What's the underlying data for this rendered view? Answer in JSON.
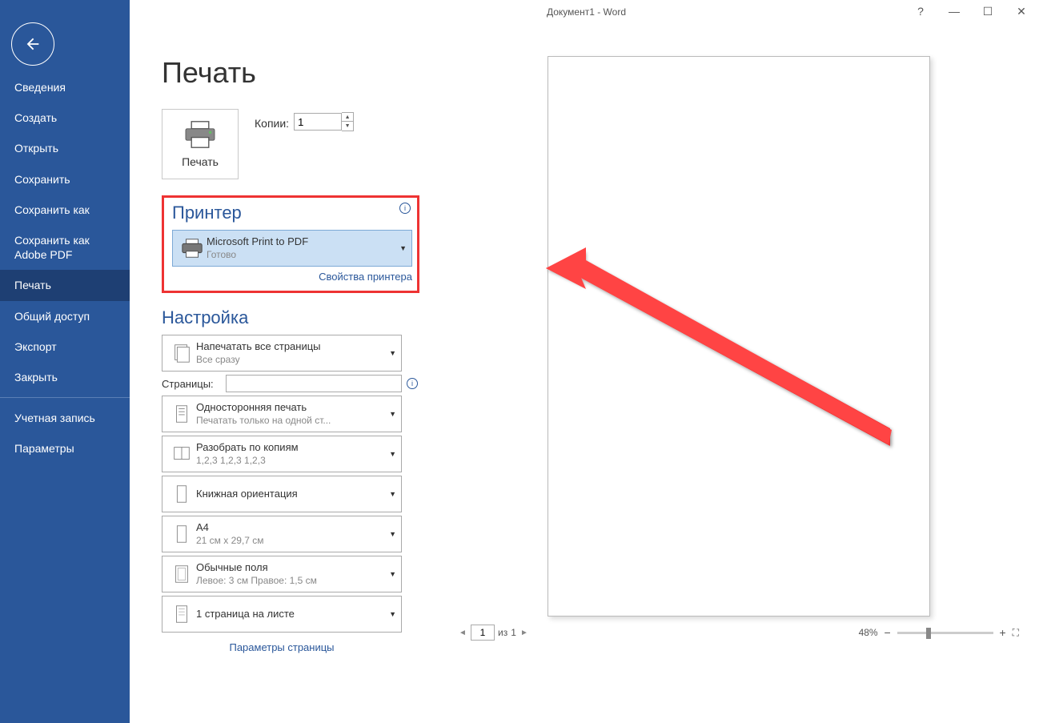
{
  "titlebar": {
    "title": "Документ1 - Word",
    "help": "?",
    "minimize": "—",
    "maximize": "☐",
    "close": "✕"
  },
  "sidebar": {
    "items": [
      "Сведения",
      "Создать",
      "Открыть",
      "Сохранить",
      "Сохранить как",
      "Сохранить как Adobe PDF",
      "Печать",
      "Общий доступ",
      "Экспорт",
      "Закрыть"
    ],
    "footer": [
      "Учетная запись",
      "Параметры"
    ]
  },
  "page": {
    "title": "Печать"
  },
  "print": {
    "button": "Печать",
    "copies_label": "Копии:",
    "copies_value": "1"
  },
  "printer": {
    "section": "Принтер",
    "name": "Microsoft Print to PDF",
    "status": "Готово",
    "properties": "Свойства принтера"
  },
  "settings": {
    "section": "Настройка",
    "print_what": {
      "title": "Напечатать все страницы",
      "sub": "Все сразу"
    },
    "pages_label": "Страницы:",
    "pages_value": "",
    "sides": {
      "title": "Односторонняя печать",
      "sub": "Печатать только на одной ст..."
    },
    "collate": {
      "title": "Разобрать по копиям",
      "sub": "1,2,3    1,2,3    1,2,3"
    },
    "orientation": {
      "title": "Книжная ориентация",
      "sub": ""
    },
    "paper": {
      "title": "A4",
      "sub": "21 см x 29,7 см"
    },
    "margins": {
      "title": "Обычные поля",
      "sub": "Левое: 3 см   Правое: 1,5 см"
    },
    "per_sheet": {
      "title": "1 страница на листе",
      "sub": ""
    },
    "page_setup": "Параметры страницы"
  },
  "preview": {
    "page_current": "1",
    "page_sep": "из",
    "page_total": "1",
    "zoom": "48%"
  }
}
